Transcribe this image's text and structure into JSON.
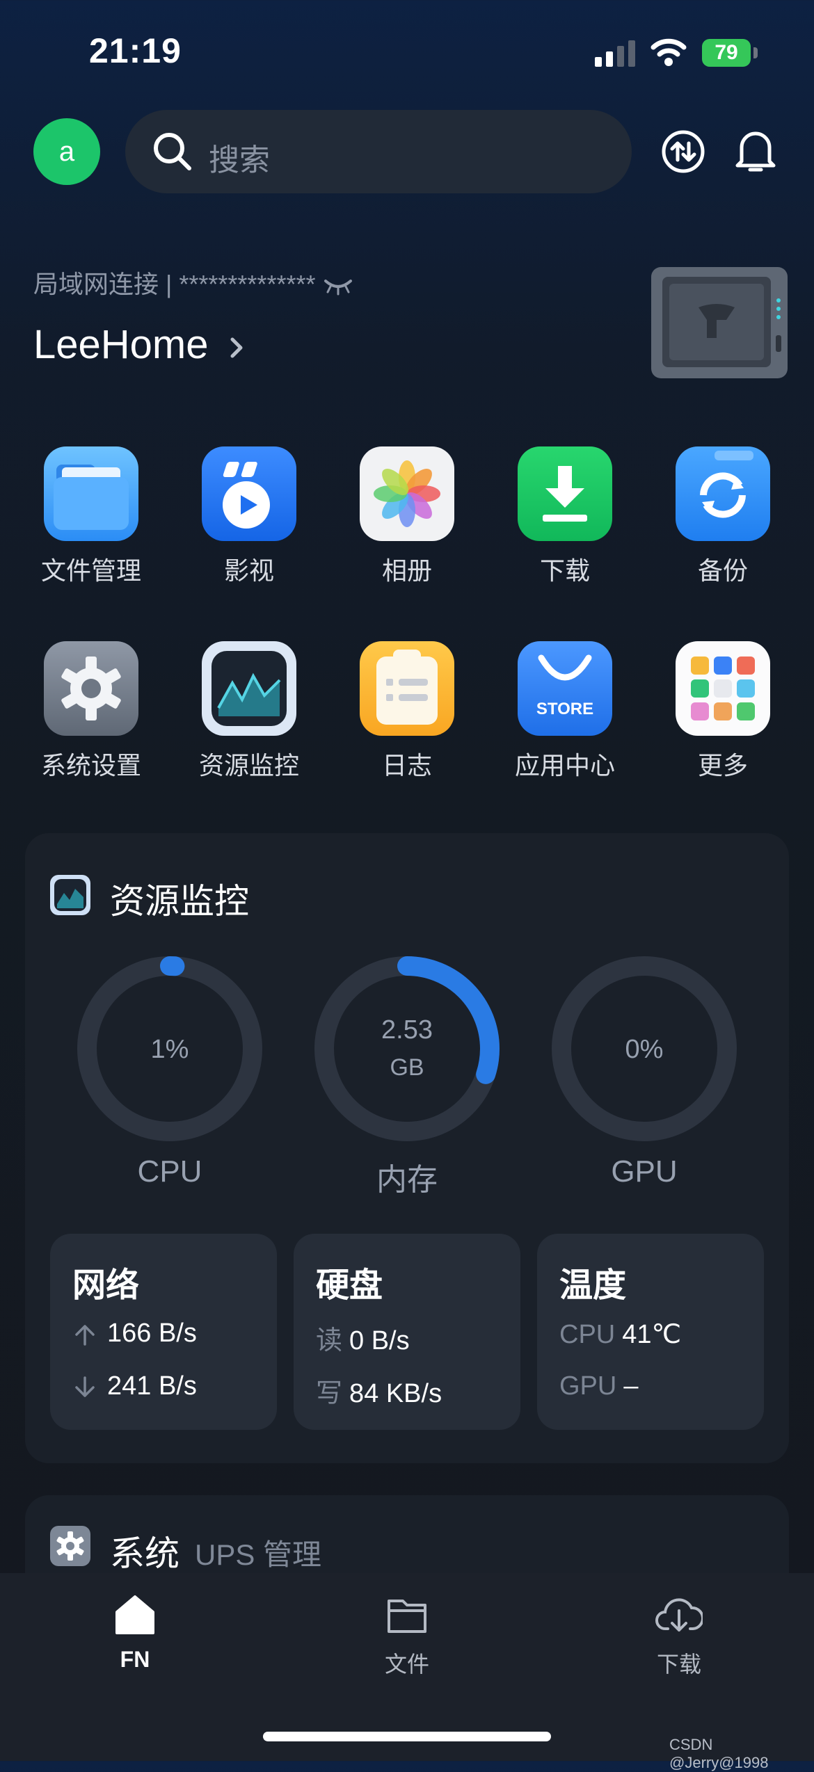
{
  "status_bar": {
    "time": "21:19",
    "battery": "79"
  },
  "header": {
    "avatar_letter": "a",
    "search_placeholder": "搜索"
  },
  "device": {
    "connection": "局域网连接 | ************** ",
    "name": "LeeHome"
  },
  "apps": [
    {
      "label": "文件管理",
      "icon": "folder-icon"
    },
    {
      "label": "影视",
      "icon": "video-icon"
    },
    {
      "label": "相册",
      "icon": "photos-icon"
    },
    {
      "label": "下载",
      "icon": "download-icon"
    },
    {
      "label": "备份",
      "icon": "backup-icon"
    },
    {
      "label": "系统设置",
      "icon": "gear-icon"
    },
    {
      "label": "资源监控",
      "icon": "monitor-icon"
    },
    {
      "label": "日志",
      "icon": "log-icon"
    },
    {
      "label": "应用中心",
      "icon": "store-icon",
      "badge": "STORE"
    },
    {
      "label": "更多",
      "icon": "more-icon"
    }
  ],
  "monitor": {
    "title": "资源监控",
    "cpu": {
      "value": "1%",
      "label": "CPU",
      "percent": 1
    },
    "memory": {
      "value": "2.53",
      "unit": "GB",
      "label": "内存",
      "percent": 30
    },
    "gpu": {
      "value": "0%",
      "label": "GPU",
      "percent": 0
    },
    "network": {
      "title": "网络",
      "up": "166 B/s",
      "down": "241 B/s"
    },
    "disk": {
      "title": "硬盘",
      "read_label": "读",
      "read": "0 B/s",
      "write_label": "写",
      "write": "84 KB/s"
    },
    "temperature": {
      "title": "温度",
      "cpu_label": "CPU",
      "cpu": "41℃",
      "gpu_label": "GPU",
      "gpu": "–"
    }
  },
  "system_card": {
    "title": "系统",
    "subtitle": "UPS 管理"
  },
  "tabs": [
    {
      "label": "FN",
      "icon": "home-icon",
      "active": true
    },
    {
      "label": "文件",
      "icon": "folder-icon"
    },
    {
      "label": "下载",
      "icon": "cloud-download-icon"
    }
  ],
  "watermark": "CSDN @Jerry@1998",
  "colors": {
    "accent": "#2a7be4",
    "avatar": "#1cc56a",
    "battery": "#35c759"
  }
}
